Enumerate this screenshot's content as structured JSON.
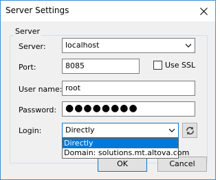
{
  "window": {
    "title": "Server Settings"
  },
  "group": {
    "label": "Server"
  },
  "fields": {
    "server": {
      "label": "Server:",
      "value": "localhost"
    },
    "port": {
      "label": "Port:",
      "value": "8085"
    },
    "use_ssl": {
      "label": "Use SSL",
      "checked": false
    },
    "username": {
      "label": "User name:",
      "value": "root"
    },
    "password": {
      "label": "Password:",
      "value": "●●●●●●●●"
    },
    "login": {
      "label": "Login:",
      "value": "Directly",
      "options": [
        "Directly",
        "Domain: solutions.mt.altova.com"
      ],
      "selected_index": 0
    }
  },
  "buttons": {
    "ok": "OK",
    "cancel": "Cancel"
  },
  "colors": {
    "accent": "#0078d7",
    "window_border": "#3a8fd6",
    "dialog_bg": "#f0f0f0"
  },
  "icons": {
    "close": "close-icon",
    "dropdown": "chevron-down-icon",
    "refresh": "refresh-icon"
  }
}
